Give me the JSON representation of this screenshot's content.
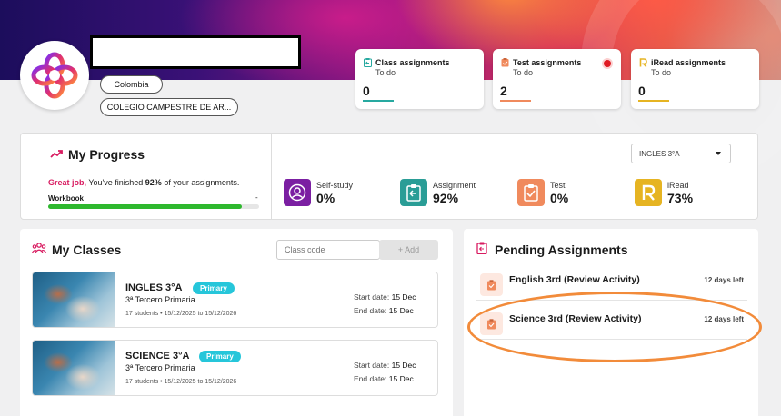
{
  "profile": {
    "country": "Colombia",
    "school": "COLEGIO CAMPESTRE DE AR..."
  },
  "summary_cards": [
    {
      "title": "Class assignments",
      "subtitle": "To do",
      "value": "0",
      "icon": "clipboard-return-icon",
      "color": "#27a9a0"
    },
    {
      "title": "Test assignments",
      "subtitle": "To do",
      "value": "2",
      "icon": "clipboard-check-icon",
      "color": "#f08a5d"
    },
    {
      "title": "iRead assignments",
      "subtitle": "To do",
      "value": "0",
      "icon": "iread-r-icon",
      "color": "#e6b422"
    }
  ],
  "progress": {
    "title": "My Progress",
    "highlight": "Great job,",
    "message_prefix": " You've finished ",
    "percent": "92%",
    "message_suffix": " of your assignments.",
    "workbook_label": "Workbook",
    "workbook_value": "-",
    "workbook_fill": 0.92,
    "class_select": "INGLES 3°A",
    "metrics": [
      {
        "label": "Self-study",
        "value": "0%",
        "icon": "person-circle-icon",
        "color": "#7b1fa2"
      },
      {
        "label": "Assignment",
        "value": "92%",
        "icon": "clipboard-return-icon",
        "color": "#2a9d96"
      },
      {
        "label": "Test",
        "value": "0%",
        "icon": "clipboard-check-icon",
        "color": "#f08a5d"
      },
      {
        "label": "iRead",
        "value": "73%",
        "icon": "iread-r-icon",
        "color": "#e6b422"
      }
    ]
  },
  "classes": {
    "title": "My Classes",
    "code_placeholder": "Class code",
    "add_label": "+ Add",
    "items": [
      {
        "name": "INGLES 3°A",
        "level": "Primary",
        "grade": "3ª Tercero Primaria",
        "meta": "17 students  •  15/12/2025 to 15/12/2026",
        "start_label": "Start date:",
        "start": "15 Dec",
        "end_label": "End date:",
        "end": "15 Dec"
      },
      {
        "name": "SCIENCE 3°A",
        "level": "Primary",
        "grade": "3ª Tercero Primaria",
        "meta": "17 students  •  15/12/2025 to 15/12/2026",
        "start_label": "Start date:",
        "start": "15 Dec",
        "end_label": "End date:",
        "end": "15 Dec"
      }
    ]
  },
  "pending": {
    "title": "Pending Assignments",
    "items": [
      {
        "name": "English 3rd (Review Activity)",
        "due": "12 days left"
      },
      {
        "name": "Science 3rd (Review Activity)",
        "due": "12 days left"
      }
    ]
  },
  "colors": {
    "accent_pink": "#d81b60",
    "highlight_ring": "#f28b3a",
    "progress_green": "#2eb82e",
    "badge_cyan": "#26c6da"
  }
}
